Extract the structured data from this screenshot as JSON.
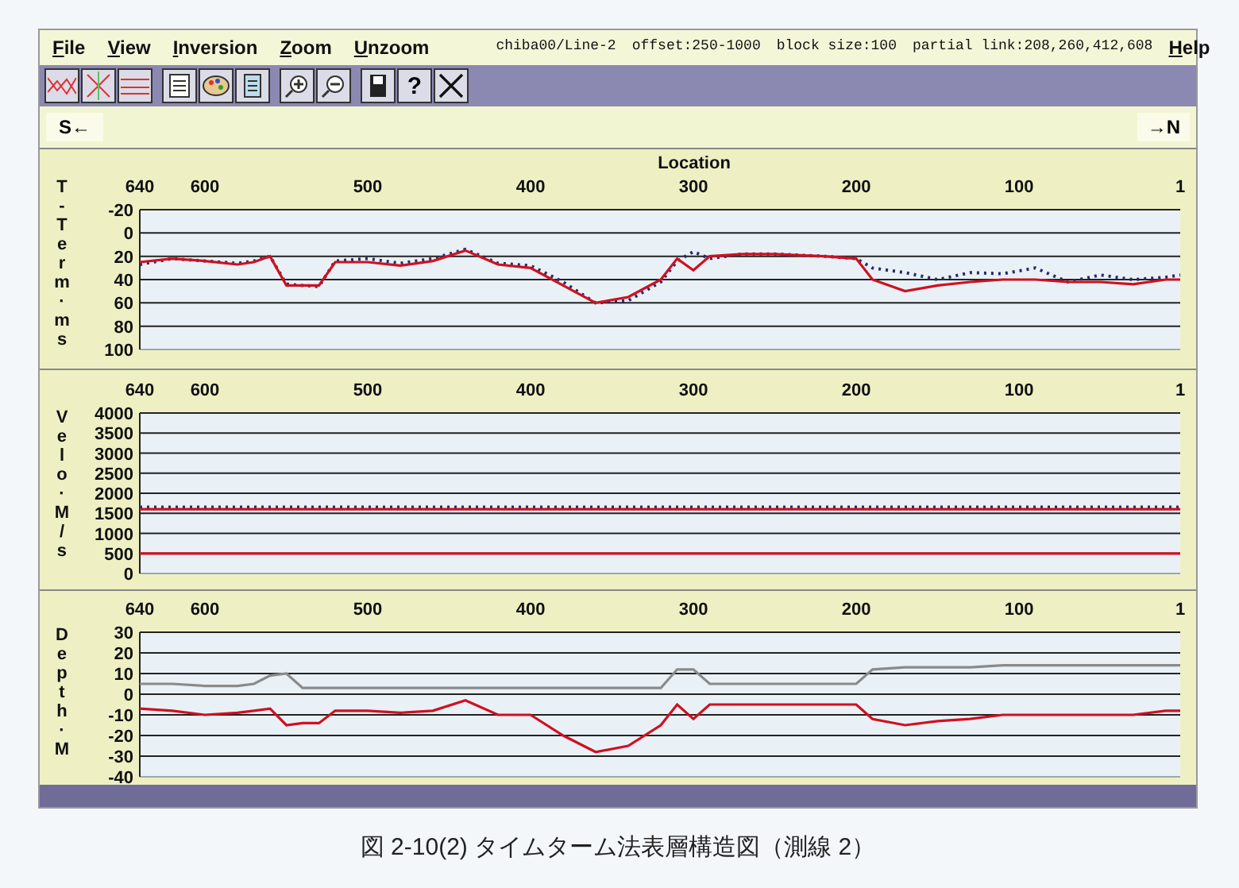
{
  "menu_bar": {
    "items": [
      "File",
      "View",
      "Inversion",
      "Zoom",
      "Unzoom"
    ],
    "info": [
      "chiba00/Line-2",
      "offset:250-1000",
      "block size:100",
      "partial link:208,260,412,608"
    ],
    "help": "Help"
  },
  "toolbar": {
    "help_label": "?"
  },
  "direction": {
    "left": "S←",
    "right": "→N"
  },
  "panels": [
    {
      "chart_data": {
        "type": "line",
        "xlabel": "Location",
        "ylabel": "T-Term·ms",
        "xlim": [
          640,
          1
        ],
        "ylim": [
          100,
          -20
        ],
        "grid": true,
        "xticks": [
          640,
          600,
          500,
          400,
          300,
          200,
          100,
          1
        ],
        "yticks": [
          -20,
          0,
          20,
          40,
          60,
          80,
          100
        ],
        "x": [
          640,
          620,
          600,
          580,
          570,
          560,
          550,
          540,
          530,
          520,
          500,
          480,
          460,
          440,
          420,
          400,
          380,
          360,
          340,
          320,
          310,
          300,
          290,
          270,
          250,
          220,
          200,
          190,
          170,
          150,
          130,
          110,
          90,
          70,
          50,
          30,
          10,
          1
        ],
        "series": [
          {
            "color": "#2a2a6a",
            "line_style": "dotted",
            "values": [
              27,
              22,
              24,
              26,
              24,
              20,
              44,
              45,
              46,
              24,
              22,
              26,
              22,
              14,
              26,
              28,
              42,
              60,
              58,
              42,
              24,
              16,
              22,
              18,
              18,
              20,
              22,
              30,
              34,
              40,
              34,
              35,
              30,
              42,
              36,
              40,
              38,
              36
            ]
          },
          {
            "color": "#d01020",
            "values": [
              25,
              22,
              24,
              27,
              25,
              20,
              45,
              45,
              45,
              25,
              25,
              28,
              24,
              15,
              27,
              30,
              45,
              60,
              55,
              40,
              22,
              32,
              20,
              18,
              18,
              20,
              22,
              40,
              50,
              45,
              42,
              40,
              40,
              42,
              42,
              44,
              40,
              40
            ]
          }
        ]
      }
    },
    {
      "chart_data": {
        "type": "line",
        "ylabel": "Velo·M/s",
        "xlim": [
          640,
          1
        ],
        "ylim": [
          0,
          4000
        ],
        "grid": true,
        "xticks": [
          640,
          600,
          500,
          400,
          300,
          200,
          100,
          1
        ],
        "yticks": [
          4000,
          3500,
          3000,
          2500,
          2000,
          1500,
          1000,
          500,
          0
        ],
        "x": [
          640,
          1
        ],
        "series": [
          {
            "color": "#2a2a6a",
            "line_style": "dotted",
            "values": [
              1650,
              1650
            ]
          },
          {
            "color": "#d01020",
            "values": [
              1600,
              1600
            ]
          },
          {
            "color": "#d01020",
            "values": [
              500,
              500
            ]
          }
        ]
      }
    },
    {
      "chart_data": {
        "type": "line",
        "ylabel": "Depth·M",
        "xlim": [
          640,
          1
        ],
        "ylim": [
          -40,
          30
        ],
        "grid": true,
        "xticks": [
          640,
          600,
          500,
          400,
          300,
          200,
          100,
          1
        ],
        "yticks": [
          30,
          20,
          10,
          0,
          -10,
          -20,
          -30,
          -40
        ],
        "x": [
          640,
          620,
          600,
          580,
          570,
          560,
          550,
          540,
          530,
          520,
          500,
          480,
          460,
          440,
          420,
          400,
          380,
          360,
          340,
          320,
          310,
          300,
          290,
          270,
          250,
          220,
          200,
          190,
          170,
          150,
          130,
          110,
          90,
          70,
          50,
          30,
          10,
          1
        ],
        "series": [
          {
            "color": "#8a8a8a",
            "values": [
              5,
              5,
              4,
              4,
              5,
              9,
              10,
              3,
              3,
              3,
              3,
              3,
              3,
              3,
              3,
              3,
              3,
              3,
              3,
              3,
              12,
              12,
              5,
              5,
              5,
              5,
              5,
              12,
              13,
              13,
              13,
              14,
              14,
              14,
              14,
              14,
              14,
              14
            ]
          },
          {
            "color": "#d01020",
            "values": [
              -7,
              -8,
              -10,
              -9,
              -8,
              -7,
              -15,
              -14,
              -14,
              -8,
              -8,
              -9,
              -8,
              -3,
              -10,
              -10,
              -20,
              -28,
              -25,
              -15,
              -5,
              -12,
              -5,
              -5,
              -5,
              -5,
              -5,
              -12,
              -15,
              -13,
              -12,
              -10,
              -10,
              -10,
              -10,
              -10,
              -8,
              -8
            ]
          }
        ]
      }
    }
  ],
  "caption": "図 2-10(2) タイムターム法表層構造図（測線 2）"
}
